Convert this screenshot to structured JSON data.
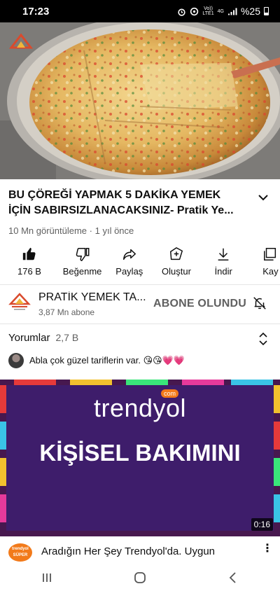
{
  "status_bar": {
    "time": "17:23",
    "network_top": "Vo))",
    "network_bottom": "LTE1",
    "network_type": "4G",
    "battery_text": "%25",
    "icons": [
      "alarm-icon",
      "data-saver-icon",
      "signal-icon",
      "battery-icon"
    ]
  },
  "video": {
    "title": "BU ÇÖREĞİ YAPMAK 5 DAKİKA YEMEK İÇİN SABIRSIZLANACAKSINIZ- Pratik Ye...",
    "views": "10 Mn görüntüleme",
    "separator": "·",
    "age": "1 yıl önce"
  },
  "actions": [
    {
      "label": "176 B",
      "icon": "like-icon"
    },
    {
      "label": "Beğenme",
      "icon": "dislike-icon"
    },
    {
      "label": "Paylaş",
      "icon": "share-icon"
    },
    {
      "label": "Oluştur",
      "icon": "create-icon"
    },
    {
      "label": "İndir",
      "icon": "download-icon"
    },
    {
      "label": "Kay",
      "icon": "save-icon"
    }
  ],
  "channel": {
    "name": "PRATİK YEMEK TA...",
    "subscribers": "3,87 Mn abone",
    "subscribe_label": "ABONE OLUNDU"
  },
  "comments": {
    "header": "Yorumlar",
    "count": "2,7 B",
    "top_comment": "Abla çok güzel tariflerin var. 😘😘💗💗"
  },
  "ad": {
    "brand": "trendyol",
    "brand_suffix": "com",
    "headline": "KİŞİSEL BAKIMINI",
    "duration": "0:16",
    "title": "Aradığın Her Şey Trendyol'da. Uygun",
    "logo_text_top": "trendyol",
    "logo_text_bottom": "SÜPER",
    "more": "⋮"
  },
  "colors": {
    "ad_background": "#3e1d6b",
    "ad_frame": "#47184f",
    "trendyol_orange": "#f27a1a"
  }
}
